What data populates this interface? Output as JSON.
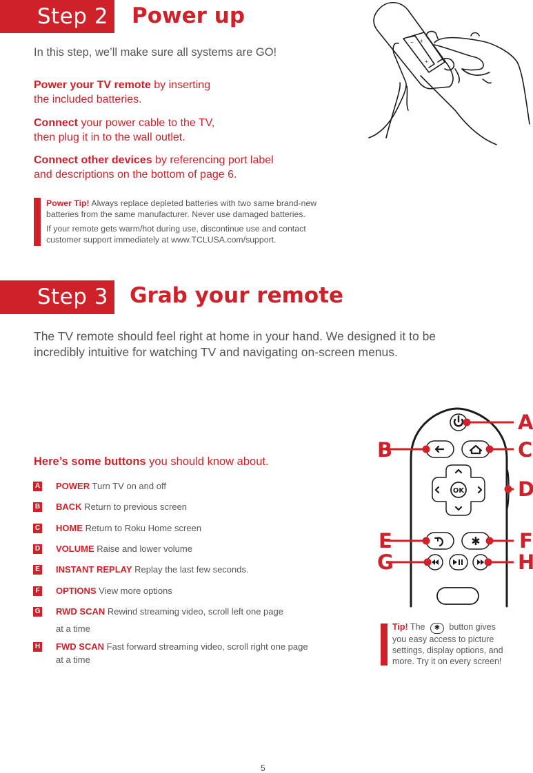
{
  "step2": {
    "label": "Step 2",
    "title": "Power up",
    "intro": "In this step, we’ll make sure all systems are GO!",
    "items": [
      {
        "bold": "Power your TV remote",
        "line1": " by inserting",
        "line2": "the included batteries."
      },
      {
        "bold": "Connect",
        "line1": " your power cable to the TV,",
        "line2": "then plug it in to the wall outlet."
      },
      {
        "bold": "Connect other devices",
        "line1": " by referencing port label",
        "line2": "and descriptions on the bottom of page 6."
      }
    ],
    "tip": {
      "label": "Power Tip!",
      "line1": " Always replace depleted batteries with two same brand-new",
      "line2": "batteries from the same manufacturer. Never use damaged batteries.",
      "line3": "If your remote gets warm/hot during use, discontinue use and contact",
      "line4": "customer support immediately at www.TCLUSA.com/support."
    },
    "illustration": "hands-inserting-batteries-into-remote"
  },
  "step3": {
    "label": "Step 3",
    "title": "Grab your remote",
    "intro_line1": "The TV remote should feel right at home in your hand. We designed it to be",
    "intro_line2": "incredibly intuitive for watching TV and navigating on-screen menus.",
    "buttons_heading_bold": "Here’s some buttons",
    "buttons_heading_rest": " you should know about.",
    "buttons": [
      {
        "letter": "A",
        "name": "POWER",
        "desc": " Turn TV on and off"
      },
      {
        "letter": "B",
        "name": "BACK",
        "desc": " Return to previous screen"
      },
      {
        "letter": "C",
        "name": "HOME",
        "desc": " Return to Roku Home screen"
      },
      {
        "letter": "D",
        "name": "VOLUME",
        "desc": " Raise and lower volume"
      },
      {
        "letter": "E",
        "name": "INSTANT REPLAY",
        "desc": " Replay the last few seconds."
      },
      {
        "letter": "F",
        "name": "OPTIONS",
        "desc": " View more options"
      },
      {
        "letter": "G",
        "name": "RWD SCAN",
        "desc": " Rewind streaming video, scroll left one page",
        "desc2": "at a time"
      },
      {
        "letter": "H",
        "name": "FWD SCAN",
        "desc": " Fast forward streaming video, scroll right one page",
        "desc2": "at a time"
      }
    ],
    "remote": {
      "ok_label": "OK",
      "callouts": [
        "A",
        "B",
        "C",
        "D",
        "E",
        "F",
        "G",
        "H"
      ]
    },
    "tip": {
      "label": "Tip!",
      "pre": " The ",
      "icon": "✱",
      "post": " button gives",
      "line2": "you easy access to picture",
      "line3": "settings, display options, and",
      "line4": "more. Try it on every screen!"
    }
  },
  "page_number": "5",
  "colors": {
    "accent": "#cf2129",
    "text": "#555555"
  }
}
